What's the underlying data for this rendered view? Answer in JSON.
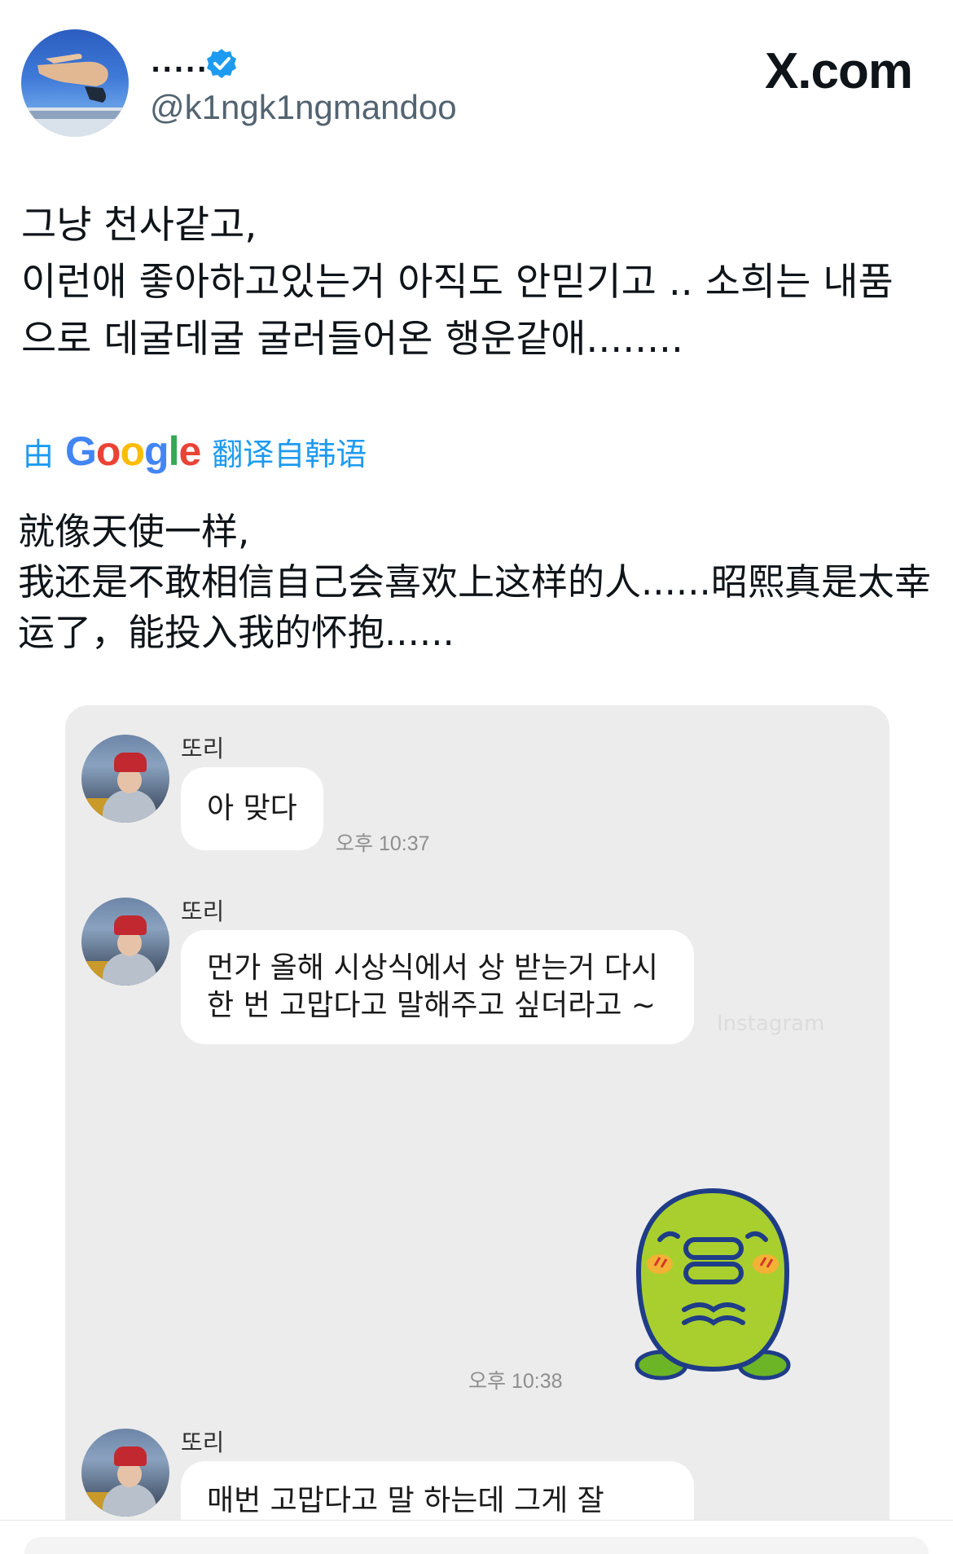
{
  "header": {
    "display_name": ".....",
    "handle": "@k1ngk1ngmandoo",
    "site_logo": "X.com",
    "badge_icon": "verified-badge-icon",
    "badge_color": "#1d9bf0"
  },
  "tweet": {
    "text": "그냥 천사같고,\n이런애  좋아하고있는거 아직도 안믿기고 .. 소희는  내품\n으로 데굴데굴 굴러들어온 행운같애........",
    "translation_prefix": "由",
    "translation_brand": "Google",
    "translation_suffix": "翻译自韩语",
    "translated_text": "就像天使一样,\n我还是不敢相信自己会喜欢上这样的人......昭熙真是太幸\n运了，能投入我的怀抱......",
    "link_color": "#1d9bf0"
  },
  "chat": {
    "messages": [
      {
        "sender": "또리",
        "text": "아 맞다",
        "time": "오후 10:37"
      },
      {
        "sender": "또리",
        "text": "먼가 올해 시상식에서 상 받는거 다시\n한 번 고맙다고 말해주고 싶더라고 ~",
        "time": ""
      },
      {
        "sender": "",
        "text": "",
        "time": "오후 10:38",
        "sticker": "green-turtle-sticker-icon"
      },
      {
        "sender": "또리",
        "text": "매번 고맙다고 말 하는데 그게 잘",
        "time": ""
      }
    ],
    "watermark": "Instagram"
  }
}
